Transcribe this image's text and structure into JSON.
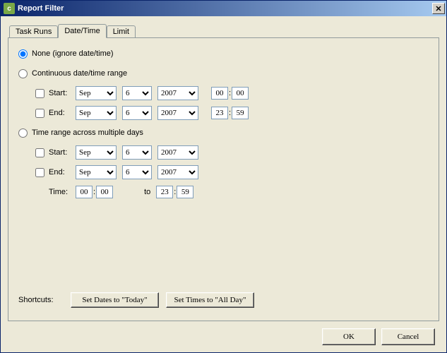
{
  "window": {
    "title": "Report Filter",
    "icon_letter": "c"
  },
  "tabs": {
    "task_runs": "Task Runs",
    "date_time": "Date/Time",
    "limit": "Limit"
  },
  "options": {
    "none": "None (ignore date/time)",
    "continuous": "Continuous date/time range",
    "multi": "Time range across multiple days"
  },
  "labels": {
    "start": "Start:",
    "end": "End:",
    "time": "Time:",
    "to": "to"
  },
  "cont": {
    "start": {
      "month": "Sep",
      "day": "6",
      "year": "2007",
      "hh": "00",
      "mm": "00"
    },
    "end": {
      "month": "Sep",
      "day": "6",
      "year": "2007",
      "hh": "23",
      "mm": "59"
    }
  },
  "multi": {
    "start": {
      "month": "Sep",
      "day": "6",
      "year": "2007"
    },
    "end": {
      "month": "Sep",
      "day": "6",
      "year": "2007"
    },
    "time_from": {
      "hh": "00",
      "mm": "00"
    },
    "time_to": {
      "hh": "23",
      "mm": "59"
    }
  },
  "shortcuts": {
    "label": "Shortcuts:",
    "set_today": "Set Dates to \"Today\"",
    "set_allday": "Set Times to \"All Day\""
  },
  "buttons": {
    "ok": "OK",
    "cancel": "Cancel"
  }
}
